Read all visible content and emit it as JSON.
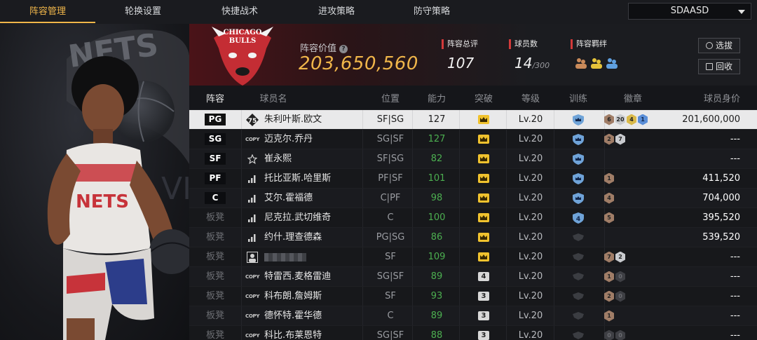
{
  "nav": {
    "tabs": [
      "阵容管理",
      "轮换设置",
      "快捷战术",
      "进攻策略",
      "防守策略"
    ],
    "active_index": 0,
    "team_select": "SDAASD"
  },
  "summary": {
    "value_label": "阵容价值",
    "value": "203,650,560",
    "stats": [
      {
        "label": "阵容总评",
        "value": "107",
        "suffix": ""
      },
      {
        "label": "球员数",
        "value": "14",
        "suffix": "/300"
      },
      {
        "label": "阵容羁绊",
        "value": "",
        "suffix": ""
      }
    ],
    "buttons": {
      "select": "选拔",
      "recycle": "回收"
    },
    "logo_text": {
      "line1": "CHICAGO",
      "line2": "BULLS"
    }
  },
  "table": {
    "headers": [
      "阵容",
      "球员名",
      "位置",
      "能力",
      "突破",
      "等级",
      "训练",
      "徽章",
      "球员身价"
    ],
    "rows": [
      {
        "slot": "PG",
        "starter": true,
        "tier": "gold",
        "tier_label": "75",
        "name": "朱利叶斯.欧文",
        "pos": "SF|SG",
        "ovr": "127",
        "brk": "crown",
        "lvl": "Lv.20",
        "train": "crown",
        "badges": [
          {
            "t": "bronze",
            "n": "6"
          },
          {
            "t": "silver",
            "n": "20"
          },
          {
            "t": "gold",
            "n": "4"
          },
          {
            "t": "blue",
            "n": "1"
          }
        ],
        "value": "201,600,000",
        "selected": true
      },
      {
        "slot": "SG",
        "starter": true,
        "tier": "copy",
        "tier_label": "COPY",
        "name": "迈克尔.乔丹",
        "pos": "SG|SF",
        "ovr": "127",
        "brk": "crown",
        "lvl": "Lv.20",
        "train": "crown",
        "badges": [
          {
            "t": "bronze",
            "n": "2"
          },
          {
            "t": "silver",
            "n": "7"
          }
        ],
        "value": "---"
      },
      {
        "slot": "SF",
        "starter": true,
        "tier": "star",
        "tier_label": "",
        "name": "崔永熙",
        "pos": "SF|SG",
        "ovr": "82",
        "brk": "crown",
        "lvl": "Lv.20",
        "train": "crown",
        "badges": [],
        "value": "---"
      },
      {
        "slot": "PF",
        "starter": true,
        "tier": "bars",
        "tier_label": "",
        "name": "托比亚斯.哈里斯",
        "pos": "PF|SF",
        "ovr": "101",
        "brk": "crown",
        "lvl": "Lv.20",
        "train": "crown",
        "badges": [
          {
            "t": "bronze",
            "n": "1"
          }
        ],
        "value": "411,520"
      },
      {
        "slot": "C",
        "starter": true,
        "tier": "bars",
        "tier_label": "",
        "name": "艾尔.霍福德",
        "pos": "C|PF",
        "ovr": "98",
        "brk": "crown",
        "lvl": "Lv.20",
        "train": "crown",
        "badges": [
          {
            "t": "bronze",
            "n": "4"
          }
        ],
        "value": "704,000"
      },
      {
        "slot": "板凳",
        "starter": false,
        "tier": "bars",
        "tier_label": "",
        "name": "尼克拉.武切维奇",
        "pos": "C",
        "ovr": "100",
        "brk": "crown",
        "lvl": "Lv.20",
        "train": "4",
        "badges": [
          {
            "t": "bronze",
            "n": "5"
          }
        ],
        "value": "395,520"
      },
      {
        "slot": "板凳",
        "starter": false,
        "tier": "bars",
        "tier_label": "",
        "name": "约什.理查德森",
        "pos": "PG|SG",
        "ovr": "86",
        "brk": "crown",
        "lvl": "Lv.20",
        "train": "none",
        "badges": [],
        "value": "539,520"
      },
      {
        "slot": "板凳",
        "starter": false,
        "tier": "person",
        "tier_label": "",
        "name": "",
        "pos": "SF",
        "ovr": "109",
        "brk": "crown",
        "lvl": "Lv.20",
        "train": "none",
        "badges": [
          {
            "t": "bronze",
            "n": "7"
          },
          {
            "t": "silver",
            "n": "2"
          }
        ],
        "value": "---"
      },
      {
        "slot": "板凳",
        "starter": false,
        "tier": "copy",
        "tier_label": "COPY",
        "name": "特雷西.麦格雷迪",
        "pos": "SG|SF",
        "ovr": "89",
        "brk": "4",
        "lvl": "Lv.20",
        "train": "none",
        "badges": [
          {
            "t": "bronze",
            "n": "1"
          },
          {
            "t": "dim",
            "n": "0"
          }
        ],
        "value": "---"
      },
      {
        "slot": "板凳",
        "starter": false,
        "tier": "copy",
        "tier_label": "COPY",
        "name": "科布朗.詹姆斯",
        "pos": "SF",
        "ovr": "93",
        "brk": "3",
        "lvl": "Lv.20",
        "train": "none",
        "badges": [
          {
            "t": "bronze",
            "n": "2"
          },
          {
            "t": "dim",
            "n": "0"
          }
        ],
        "value": "---"
      },
      {
        "slot": "板凳",
        "starter": false,
        "tier": "copy",
        "tier_label": "COPY",
        "name": "德怀特.霍华德",
        "pos": "C",
        "ovr": "89",
        "brk": "3",
        "lvl": "Lv.20",
        "train": "none",
        "badges": [
          {
            "t": "bronze",
            "n": "1"
          }
        ],
        "value": "---"
      },
      {
        "slot": "板凳",
        "starter": false,
        "tier": "copy",
        "tier_label": "COPY",
        "name": "科比.布莱恩特",
        "pos": "SG|SF",
        "ovr": "88",
        "brk": "3",
        "lvl": "Lv.20",
        "train": "none",
        "badges": [
          {
            "t": "dim",
            "n": "0"
          },
          {
            "t": "dim",
            "n": "0"
          }
        ],
        "value": "---"
      }
    ]
  },
  "colors": {
    "accent": "#f0b64a",
    "red": "#d23a3a",
    "ability": "#4caf50",
    "train_blue": "#6fa3d8"
  }
}
